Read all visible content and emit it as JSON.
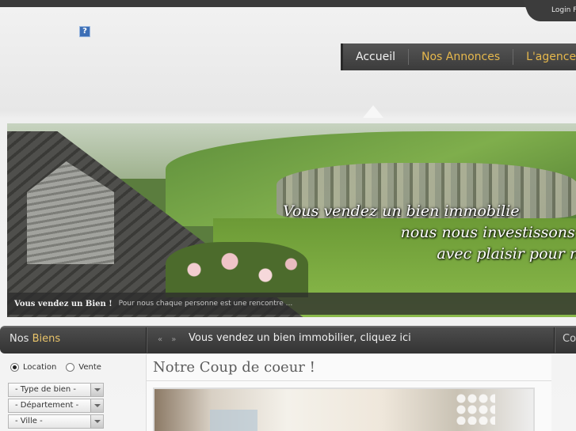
{
  "header": {
    "login_text": "Login F",
    "help_icon": "?",
    "icon_names": [
      "help-icon"
    ]
  },
  "nav": {
    "items": [
      {
        "label": "Accueil"
      },
      {
        "label": "Nos Annonces"
      },
      {
        "label": "L'agence"
      }
    ],
    "accent_color": "#e6b84c"
  },
  "banner": {
    "slogan_lines": [
      "Vous vendez un bien immobilie",
      "nous nous investissons touj",
      "avec plaisir pour nos c"
    ],
    "caption_title": "Vous vendez un Bien !",
    "caption_text": "Pour nous chaque personne est une rencontre ..."
  },
  "bar": {
    "left_prefix": "Nos",
    "left_word": "Biens",
    "arrows": "«  »",
    "message": "Vous vendez un bien immobilier, cliquez ici",
    "right_text": "Co"
  },
  "search": {
    "radio_options": [
      {
        "label": "Location",
        "checked": true
      },
      {
        "label": "Vente",
        "checked": false
      }
    ],
    "selects": [
      {
        "value": "- Type de bien -"
      },
      {
        "value": "- Département -"
      },
      {
        "value": "- Ville -"
      }
    ]
  },
  "featured": {
    "title": "Notre Coup de coeur !"
  }
}
